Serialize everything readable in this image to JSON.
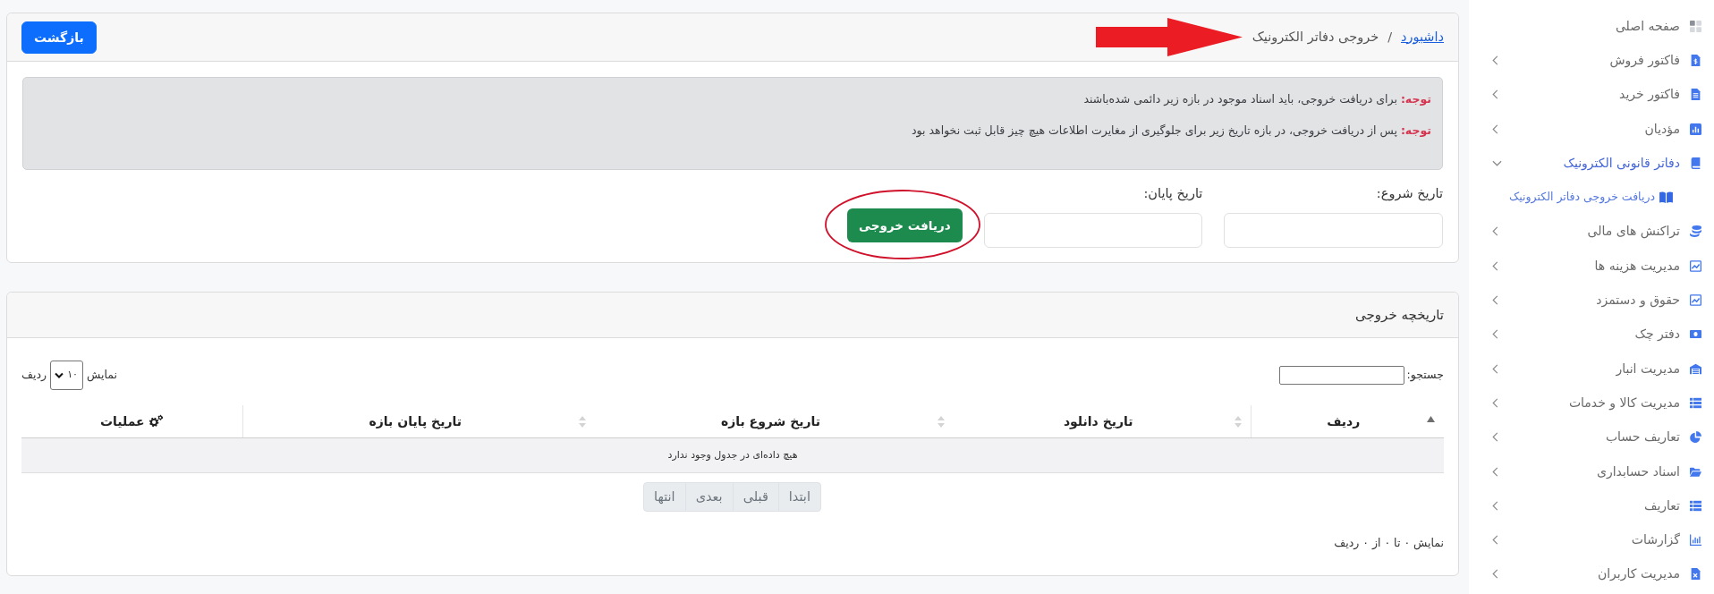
{
  "sidebar": {
    "home": {
      "label": "صفحه اصلی"
    },
    "items": [
      {
        "label": "فاکتور فروش",
        "expanded": false
      },
      {
        "label": "فاکتور خرید",
        "expanded": false
      },
      {
        "label": "مؤدیان",
        "expanded": false
      },
      {
        "label": "دفاتر قانونی الکترونیک",
        "expanded": true,
        "children": [
          {
            "label": "دریافت خروجی دفاتر الکترونیک",
            "selected": true
          }
        ]
      },
      {
        "label": "تراکنش های مالی",
        "expanded": false
      },
      {
        "label": "مدیریت هزینه ها",
        "expanded": false
      },
      {
        "label": "حقوق و دستمزد",
        "expanded": false
      },
      {
        "label": "دفتر چک",
        "expanded": false
      },
      {
        "label": "مدیریت انبار",
        "expanded": false
      },
      {
        "label": "مدیریت کالا و خدمات",
        "expanded": false
      },
      {
        "label": "تعاریف حساب",
        "expanded": false
      },
      {
        "label": "اسناد حسابداری",
        "expanded": false
      },
      {
        "label": "تعاریف",
        "expanded": false
      },
      {
        "label": "گزارشات",
        "expanded": false
      },
      {
        "label": "مدیریت کاربران",
        "expanded": false
      }
    ]
  },
  "header": {
    "breadcrumb": {
      "items": [
        {
          "label": "داشبورد",
          "kind": "link"
        },
        {
          "label": "خروجی دفاتر الکترونیک",
          "kind": "current"
        }
      ],
      "separator": "/"
    },
    "arrow_annotation": true,
    "back_button": "بازگشت"
  },
  "notices": [
    "**توجه:** برای دریافت خروجی، باید اسناد موجود در بازه زیر دائمی شده‌باشند",
    "**توجه:** پس از دریافت خروجی، در بازه تاریخ زیر برای جلوگیری از مغایرت اطلاعات هیچ چیز قابل ثبت نخواهد بود"
  ],
  "date_fields": [
    {
      "label": "تاریخ شروع:"
    },
    {
      "label": "تاریخ پایان:"
    }
  ],
  "export_button": {
    "label": "دریافت خروجی",
    "circled": true
  },
  "history": {
    "title": "تاریخچه خروجی",
    "search_label": "جستجو:",
    "length": {
      "prefix": "نمایش",
      "value": "۱۰",
      "suffix": "ردیف"
    },
    "columns": [
      {
        "label": "ردیف",
        "kind": "data",
        "sortable": true,
        "sorted_ascending": true
      },
      {
        "label": "تاریخ دانلود",
        "kind": "data",
        "sortable": true,
        "sorted_ascending": false
      },
      {
        "label": "تاریخ شروع بازه",
        "kind": "data",
        "sortable": true,
        "sorted_ascending": false
      },
      {
        "label": "تاریخ پایان بازه",
        "kind": "data",
        "sortable": true,
        "sorted_ascending": false
      },
      {
        "label": "عملیات",
        "kind": "actions",
        "sortable": false,
        "sorted_ascending": false
      }
    ],
    "empty_message": "هیچ داده‌ای در جدول وجود ندارد",
    "pagination": [
      {
        "label": "ابتدا",
        "disabled": true
      },
      {
        "label": "قبلی",
        "disabled": true
      },
      {
        "label": "بعدی",
        "disabled": true
      },
      {
        "label": "انتها",
        "disabled": true
      }
    ],
    "info": "نمایش ۰ تا ۰ از ۰ ردیف"
  }
}
